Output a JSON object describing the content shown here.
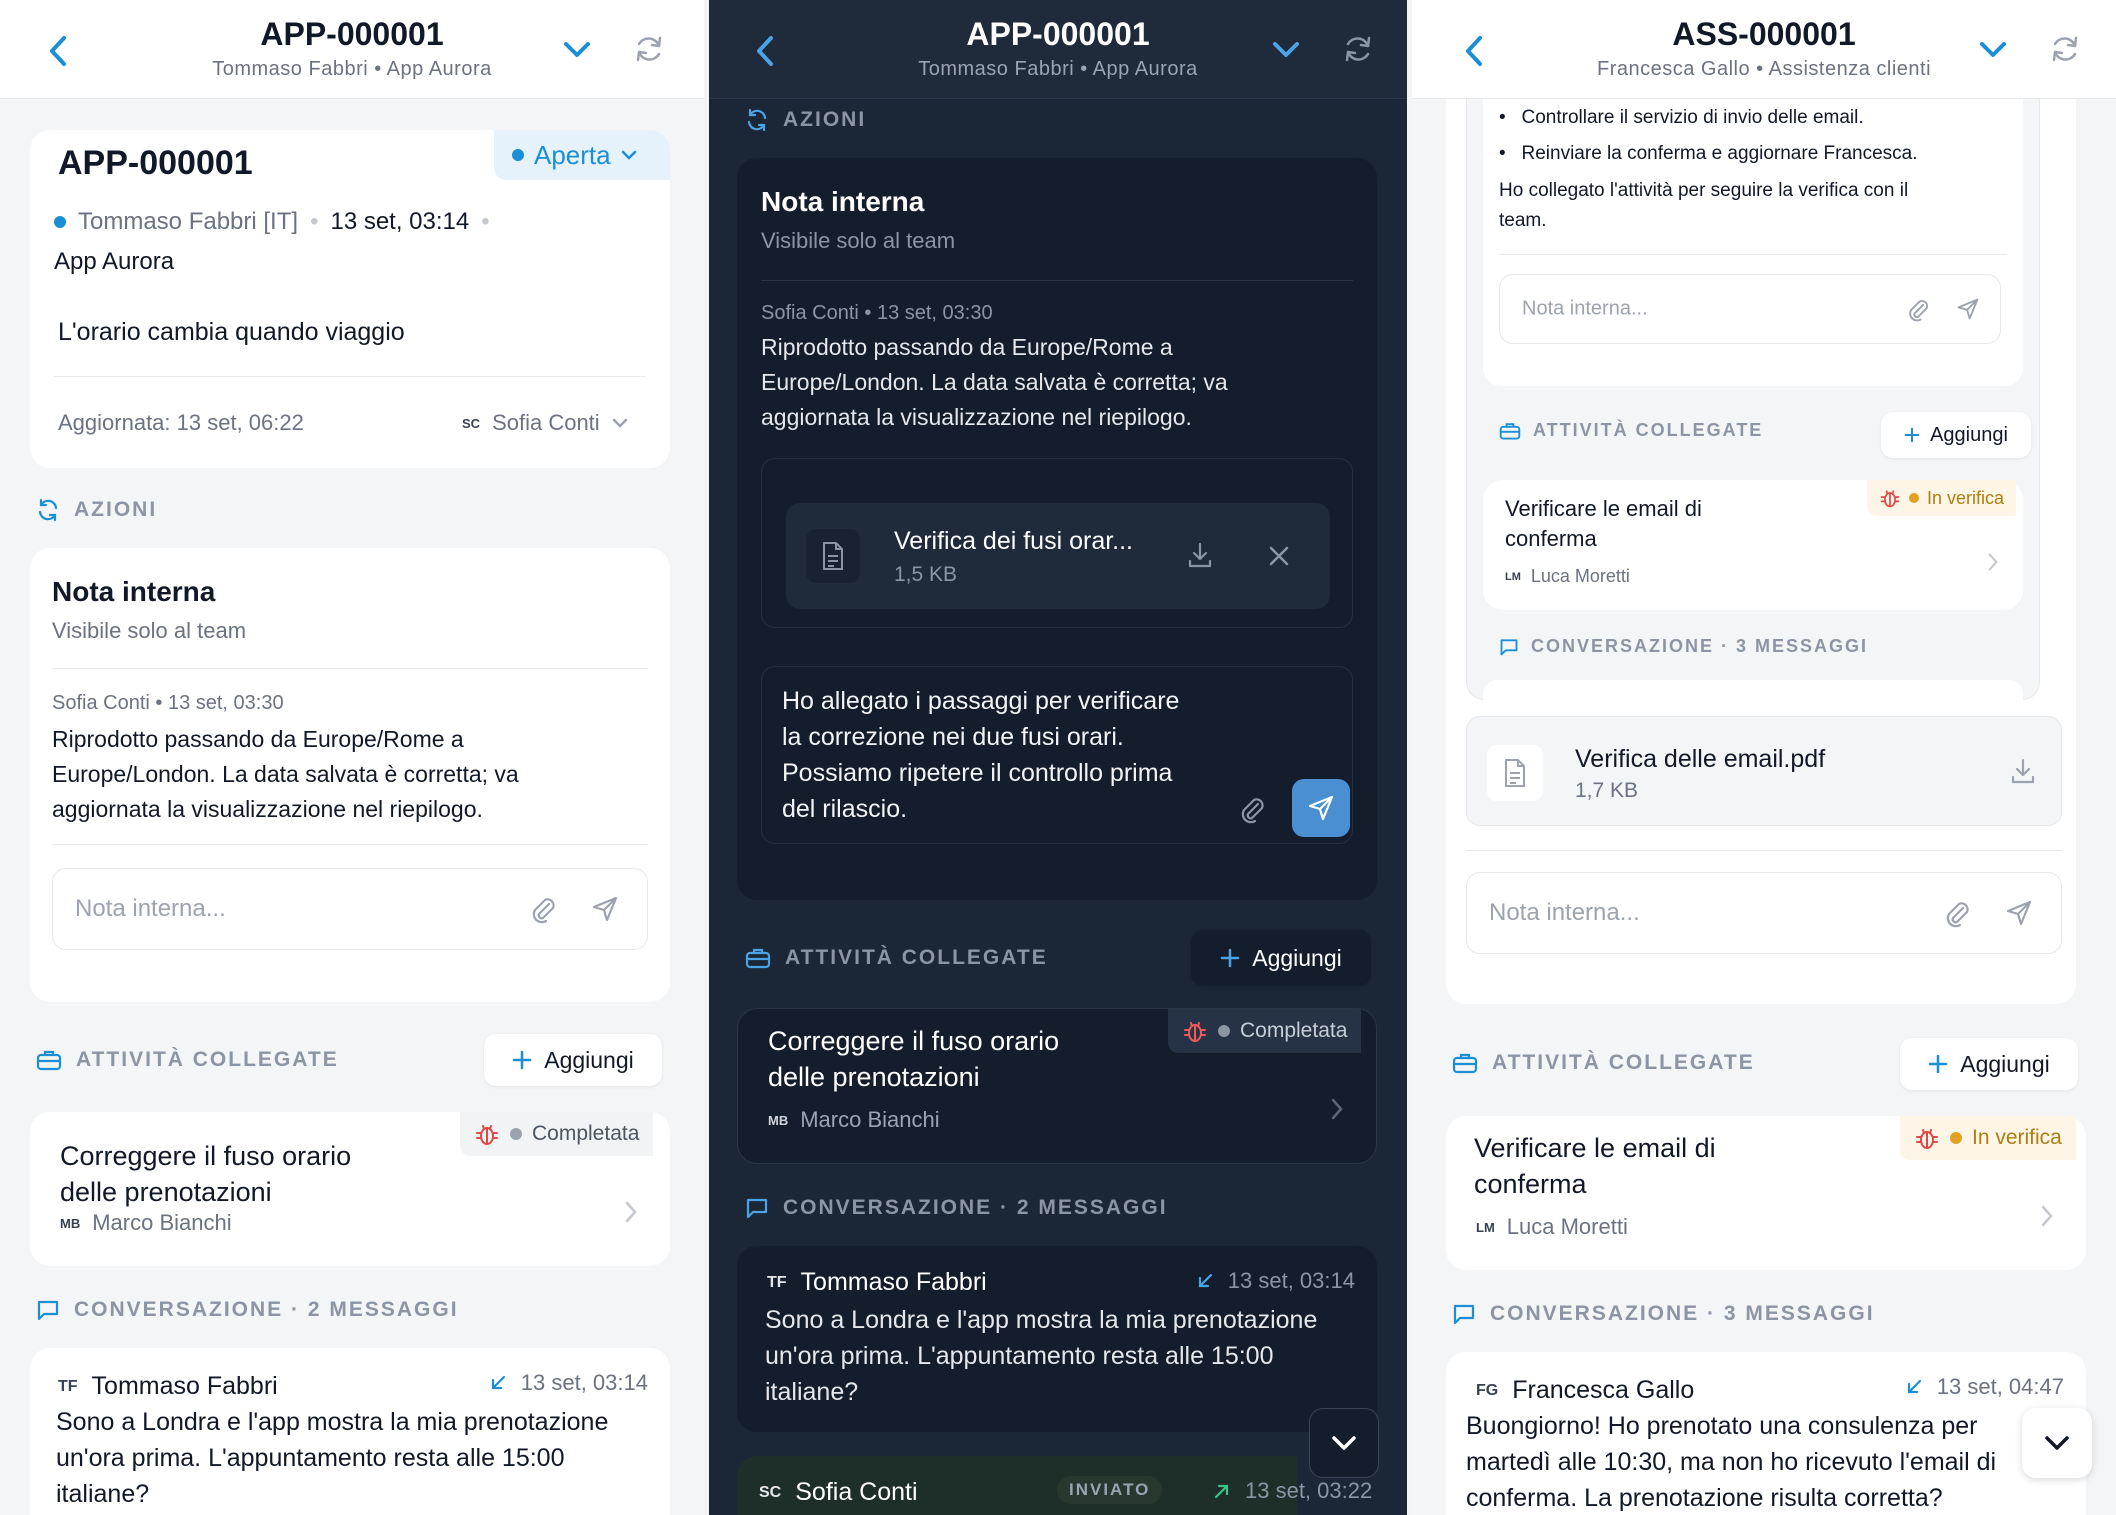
{
  "p1": {
    "header": {
      "title": "APP-000001",
      "subtitle": "Tommaso Fabbri • App Aurora"
    },
    "ticket": {
      "id": "APP-000001",
      "status": "Aperta",
      "customer": "Tommaso Fabbri [IT]",
      "date": "13 set, 03:14",
      "product": "App Aurora",
      "subject": "L'orario cambia quando viaggio",
      "updated": "Aggiornata: 13 set, 06:22",
      "assignee_initials": "SC",
      "assignee": "Sofia Conti"
    },
    "actions": {
      "title": "AZIONI",
      "note_title": "Nota interna",
      "note_sub": "Visibile solo al team",
      "note_meta": "Sofia Conti • 13 set, 03:30",
      "note_l1": "Riprodotto passando da Europe/Rome a",
      "note_l2": "Europe/London. La data salvata è corretta; va",
      "note_l3": "aggiornata la visualizzazione nel riepilogo.",
      "placeholder": "Nota interna..."
    },
    "tasks": {
      "title": "ATTIVITÀ COLLEGATE",
      "add": "Aggiungi",
      "task_l1": "Correggere il fuso orario",
      "task_l2": "delle prenotazioni",
      "status": "Completata",
      "owner_initials": "MB",
      "owner": "Marco Bianchi"
    },
    "conv": {
      "title": "CONVERSAZIONE · 2 MESSAGGI",
      "initials": "TF",
      "author": "Tommaso Fabbri",
      "time": "13 set, 03:14",
      "l1": "Sono a Londra e l'app mostra la mia prenotazione",
      "l2": "un'ora prima. L'appuntamento resta alle 15:00",
      "l3": "italiane?"
    }
  },
  "p2": {
    "header": {
      "title": "APP-000001",
      "subtitle": "Tommaso Fabbri • App Aurora"
    },
    "actions": {
      "title": "AZIONI",
      "note_title": "Nota interna",
      "note_sub": "Visibile solo al team",
      "note_meta": "Sofia Conti • 13 set, 03:30",
      "note_l1": "Riprodotto passando da Europe/Rome a",
      "note_l2": "Europe/London. La data salvata è corretta; va",
      "note_l3": "aggiornata la visualizzazione nel riepilogo."
    },
    "attachment": {
      "name": "Verifica dei fusi orar...",
      "size": "1,5 KB"
    },
    "draft": {
      "l1": "Ho allegato i passaggi per verificare",
      "l2": "la correzione nei due fusi orari.",
      "l3": "Possiamo ripetere il controllo prima",
      "l4": "del rilascio."
    },
    "tasks": {
      "title": "ATTIVITÀ COLLEGATE",
      "add": "Aggiungi",
      "task_l1": "Correggere il fuso orario",
      "task_l2": "delle prenotazioni",
      "status": "Completata",
      "owner_initials": "MB",
      "owner": "Marco Bianchi"
    },
    "conv": {
      "title": "CONVERSAZIONE · 2 MESSAGGI",
      "initials": "TF",
      "author": "Tommaso Fabbri",
      "time": "13 set, 03:14",
      "l1": "Sono a Londra e l'app mostra la mia prenotazione",
      "l2": "un'ora prima. L'appuntamento resta alle 15:00",
      "l3": "italiane?",
      "m2_initials": "SC",
      "m2_author": "Sofia Conti",
      "m2_badge": "INVIATO",
      "m2_time": "13 set, 03:22"
    }
  },
  "p3": {
    "header": {
      "title": "ASS-000001",
      "subtitle": "Francesca Gallo • Assistenza clienti"
    },
    "nested": {
      "b1": "Controllare il servizio di invio delle email.",
      "b2": "Reinviare la conferma e aggiornare Francesca.",
      "p1": "Ho collegato l'attività per seguire la verifica con il",
      "p2": "team.",
      "placeholder": "Nota interna...",
      "tasks_title": "ATTIVITÀ COLLEGATE",
      "add": "Aggiungi",
      "task_l1": "Verificare le email di",
      "task_l2": "conferma",
      "status": "In verifica",
      "owner_initials": "LM",
      "owner": "Luca Moretti",
      "conv_title": "CONVERSAZIONE · 3 MESSAGGI"
    },
    "attachment": {
      "name": "Verifica delle email.pdf",
      "size": "1,7 KB"
    },
    "placeholder": "Nota interna...",
    "tasks": {
      "title": "ATTIVITÀ COLLEGATE",
      "add": "Aggiungi",
      "task_l1": "Verificare le email di",
      "task_l2": "conferma",
      "status": "In verifica",
      "owner_initials": "LM",
      "owner": "Luca Moretti"
    },
    "conv": {
      "title": "CONVERSAZIONE · 3 MESSAGGI",
      "initials": "FG",
      "author": "Francesca Gallo",
      "time": "13 set, 04:47",
      "l1": "Buongiorno! Ho prenotato una consulenza per",
      "l2": "martedì alle 10:30, ma non ho ricevuto l'email di",
      "l3": "conferma. La prenotazione risulta corretta?"
    }
  },
  "colors": {
    "accent": "#1a8fd6",
    "send_active": "#4a8fd1",
    "bug": "#e04848",
    "warn": "#e0a020"
  }
}
